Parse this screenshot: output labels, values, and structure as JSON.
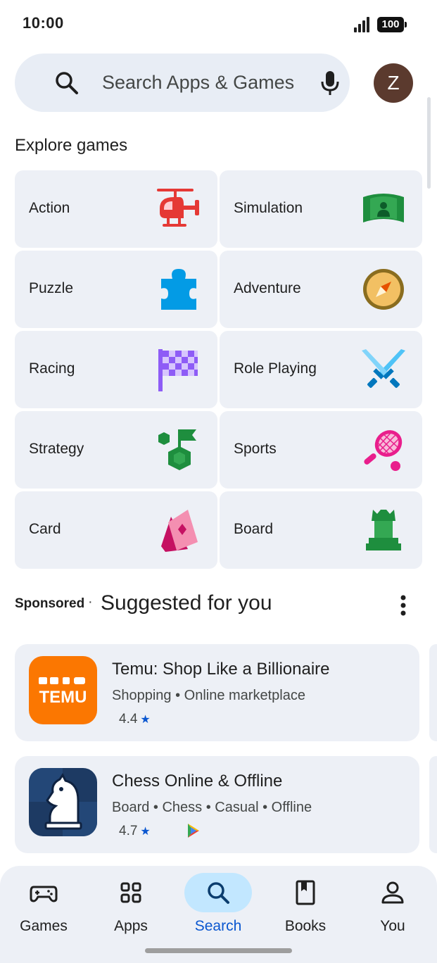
{
  "status_bar": {
    "time": "10:00",
    "battery": "100"
  },
  "search": {
    "placeholder": "Search Apps & Games",
    "avatar_initial": "Z"
  },
  "explore": {
    "title": "Explore games",
    "categories": [
      {
        "label": "Action",
        "icon": "helicopter-icon"
      },
      {
        "label": "Simulation",
        "icon": "simulation-icon"
      },
      {
        "label": "Puzzle",
        "icon": "puzzle-piece-icon"
      },
      {
        "label": "Adventure",
        "icon": "compass-icon"
      },
      {
        "label": "Racing",
        "icon": "checkered-flag-icon"
      },
      {
        "label": "Role Playing",
        "icon": "crossed-swords-icon"
      },
      {
        "label": "Strategy",
        "icon": "strategy-flag-icon"
      },
      {
        "label": "Sports",
        "icon": "tennis-racket-icon"
      },
      {
        "label": "Card",
        "icon": "playing-cards-icon"
      },
      {
        "label": "Board",
        "icon": "chess-rook-icon"
      }
    ]
  },
  "suggested": {
    "sponsored_label": "Sponsored",
    "separator": "·",
    "title": "Suggested for you",
    "apps": [
      {
        "name": "Temu: Shop Like a Billionaire",
        "tags": "Shopping • Online marketplace",
        "rating": "4.4",
        "icon_text": "TEMU",
        "icon_color": "#fb7701"
      },
      {
        "name": "Chess Online & Offline",
        "tags": "Board • Chess • Casual • Offline",
        "rating": "4.7",
        "icon_color": "#1d3a63"
      }
    ]
  },
  "bottom_nav": {
    "items": [
      {
        "label": "Games",
        "icon": "gamepad-icon"
      },
      {
        "label": "Apps",
        "icon": "apps-grid-icon"
      },
      {
        "label": "Search",
        "icon": "search-icon",
        "active": true
      },
      {
        "label": "Books",
        "icon": "book-icon"
      },
      {
        "label": "You",
        "icon": "person-icon"
      }
    ]
  },
  "colors": {
    "accent": "#0b57d0",
    "active_pill": "#c2e7ff",
    "surface": "#edf0f6"
  }
}
